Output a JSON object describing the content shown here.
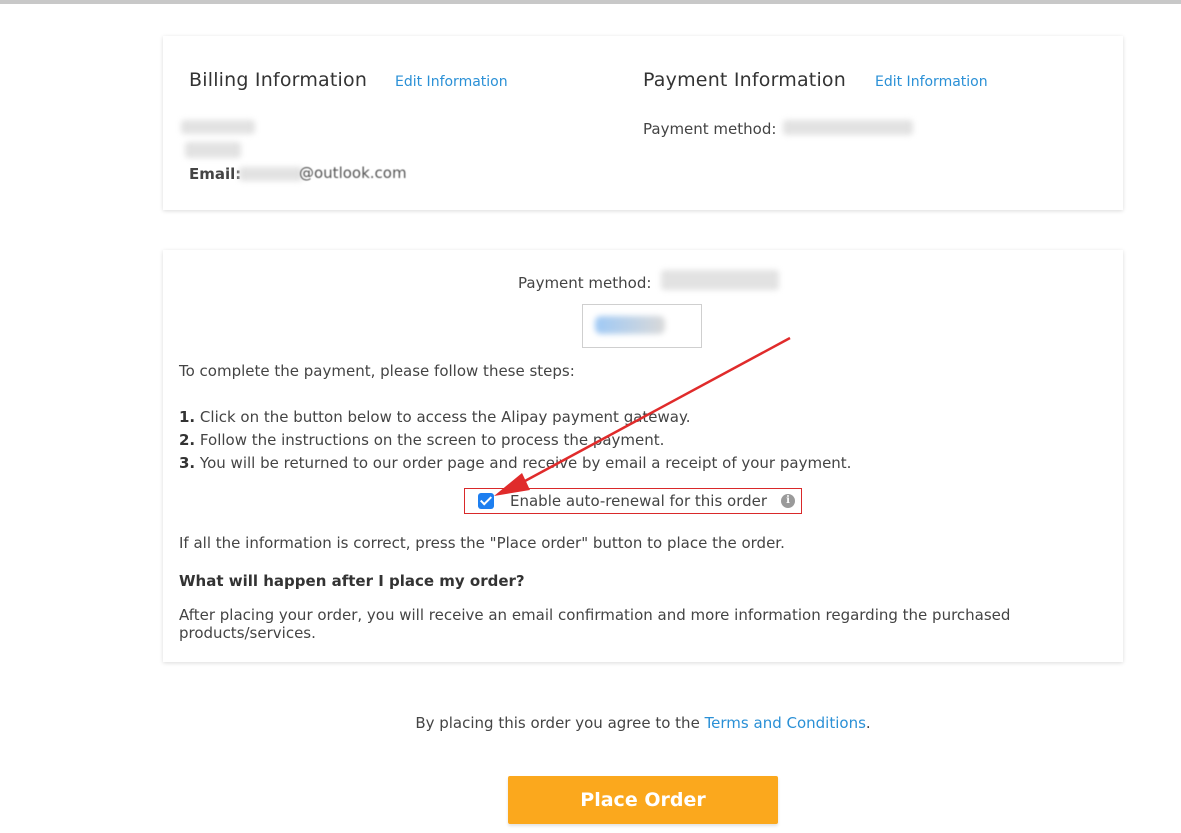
{
  "billing": {
    "title": "Billing Information",
    "edit_label": "Edit Information",
    "email_label": "Email:",
    "email_value_visible": "@outlook.com"
  },
  "payment_info": {
    "title": "Payment Information",
    "edit_label": "Edit Information",
    "method_label": "Payment method:"
  },
  "payment_panel": {
    "method_label": "Payment method:",
    "intro": "To complete the payment, please follow these steps:",
    "steps": [
      {
        "num": "1.",
        "text": "Click on the button below to access the Alipay payment gateway."
      },
      {
        "num": "2.",
        "text": "Follow the instructions on the screen to process the payment."
      },
      {
        "num": "3.",
        "text": "You will be returned to our order page and receive by email a receipt of your payment."
      }
    ],
    "auto_renew": {
      "label": "Enable auto-renewal for this order",
      "checked": true,
      "icon": "info-icon"
    },
    "confirm_text": "If all the information is correct, press the \"Place order\" button to place the order.",
    "faq_question": "What will happen after I place my order?",
    "faq_answer": "After placing your order, you will receive an email confirmation and more information regarding the purchased products/services."
  },
  "terms": {
    "prefix": "By placing this order you agree to the ",
    "link": "Terms and Conditions",
    "suffix": "."
  },
  "place_order_label": "Place Order",
  "colors": {
    "link": "#2a90d6",
    "button": "#fba81d",
    "annotation": "#e02b2b",
    "checkbox": "#1e7ff0"
  }
}
